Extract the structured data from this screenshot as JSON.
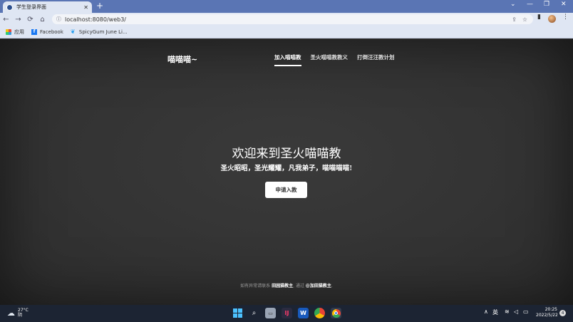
{
  "browser": {
    "tab_title": "学生登录界面",
    "tab_close": "✕",
    "new_tab": "+",
    "url": "localhost:8080/web3/",
    "window_controls": [
      "⌄",
      "—",
      "❐",
      "✕"
    ],
    "bookmarks": [
      {
        "label": "应用",
        "icon": "apps-icon"
      },
      {
        "label": "Facebook",
        "icon": "facebook-icon"
      },
      {
        "label": "SpicyGum June Li...",
        "icon": "bird-icon"
      }
    ]
  },
  "site": {
    "brand": "喵喵喵~",
    "nav": [
      {
        "label": "加入喵喵教",
        "active": true
      },
      {
        "label": "圣火喵喵教教义",
        "active": false
      },
      {
        "label": "打倒汪汪教计划",
        "active": false
      }
    ],
    "hero_title": "欢迎来到圣火喵喵教",
    "hero_subtitle": "圣火昭昭，圣光耀耀，凡我弟子，喵喵喵喵!",
    "cta_label": "申请入教",
    "footer": {
      "prefix": "如有异常请联系",
      "contact": "田园猫教主",
      "middle": ", 通过",
      "handle": "@加田猫教主",
      "suffix": "."
    }
  },
  "taskbar": {
    "temperature": "27°C",
    "weather": "阴",
    "ime": "英",
    "time": "20:25",
    "date": "2022/5/22",
    "notification_count": "4"
  },
  "colors": {
    "page_bg": "#333333",
    "chrome_bg": "#dfe6f3",
    "tabbar_bg": "#5a75b4",
    "taskbar_bg": "#1c2433"
  }
}
